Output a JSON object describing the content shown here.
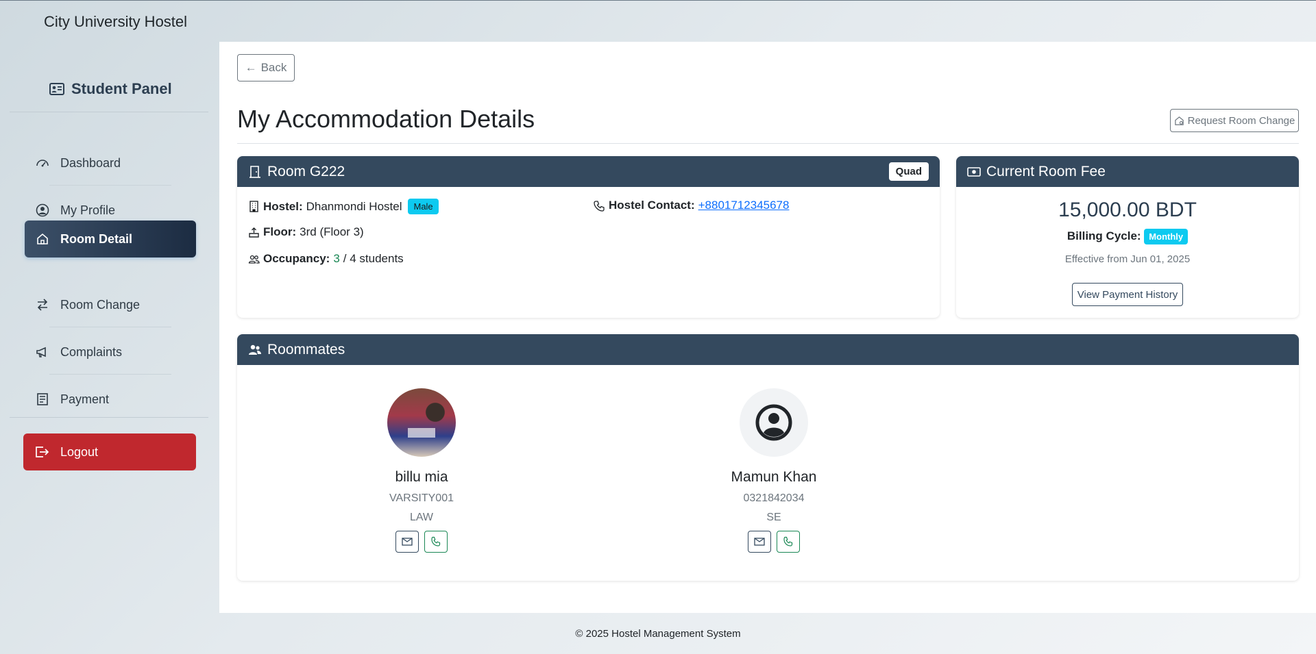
{
  "app": {
    "brand": "City University Hostel"
  },
  "sidebar": {
    "title": "Student Panel",
    "items": [
      {
        "label": "Dashboard",
        "icon": "speedometer-icon"
      },
      {
        "label": "My Profile",
        "icon": "person-circle-icon"
      },
      {
        "label": "Room Detail",
        "icon": "house-icon",
        "active": true
      },
      {
        "label": "Room Change",
        "icon": "arrow-left-right-icon"
      },
      {
        "label": "Complaints",
        "icon": "megaphone-icon"
      },
      {
        "label": "Payment",
        "icon": "receipt-icon"
      }
    ],
    "logout": "Logout"
  },
  "main": {
    "back": "Back",
    "title": "My Accommodation Details",
    "request_change": "Request Room Change",
    "room": {
      "title": "Room G222",
      "type": "Quad",
      "hostel_label": "Hostel:",
      "hostel_value": "Dhanmondi Hostel",
      "gender": "Male",
      "contact_label": "Hostel Contact:",
      "contact_value": "+8801712345678",
      "floor_label": "Floor:",
      "floor_value": "3rd (Floor 3)",
      "occupancy_label": "Occupancy:",
      "occupancy_current": "3",
      "occupancy_rest": "/ 4 students"
    },
    "fee": {
      "title": "Current Room Fee",
      "amount": "15,000.00 BDT",
      "cycle_label": "Billing Cycle:",
      "cycle_value": "Monthly",
      "effective": "Effective from Jun 01, 2025",
      "history_button": "View Payment History"
    },
    "roommates": {
      "title": "Roommates",
      "list": [
        {
          "name": "billu mia",
          "id": "VARSITY001",
          "dept": "LAW"
        },
        {
          "name": "Mamun Khan",
          "id": "0321842034",
          "dept": "SE"
        }
      ]
    }
  },
  "footer": {
    "text": "© 2025 Hostel Management System"
  },
  "colors": {
    "header": "#34495e",
    "active_nav": "#1c2c42",
    "logout": "#c0282e",
    "badge": "#0dcaf0"
  }
}
